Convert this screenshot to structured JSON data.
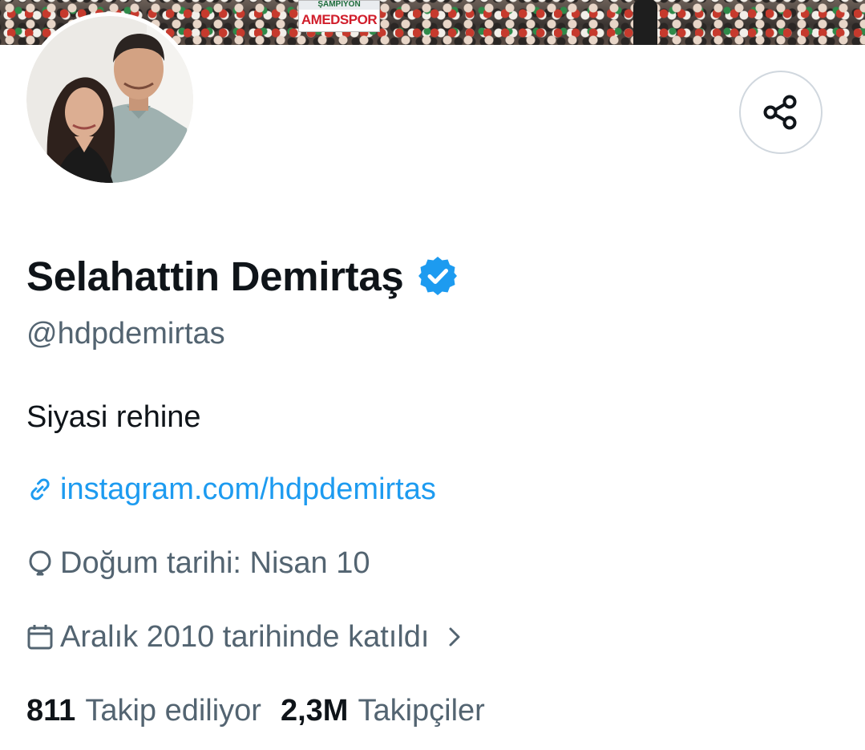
{
  "banner": {
    "sign_top": "ŞAMPİYON",
    "sign_main": "AMEDSPOR"
  },
  "profile": {
    "display_name": "Selahattin Demirtaş",
    "verified": true,
    "handle": "@hdpdemirtas",
    "bio": "Siyasi rehine",
    "link": "instagram.com/hdpdemirtas",
    "birthday": "Doğum tarihi: Nisan 10",
    "joined": "Aralık 2010 tarihinde katıldı"
  },
  "stats": {
    "following_count": "811",
    "following_label": "Takip ediliyor",
    "followers_count": "2,3M",
    "followers_label": "Takipçiler"
  },
  "icons": {
    "share": "share-icon",
    "verified": "verified-badge-icon",
    "link": "link-icon",
    "birthday": "balloon-icon",
    "joined": "calendar-icon",
    "chevron": "chevron-right-icon"
  },
  "colors": {
    "text_primary": "#0f1419",
    "text_secondary": "#536471",
    "accent": "#1d9bf0",
    "border": "#d0d7de"
  }
}
